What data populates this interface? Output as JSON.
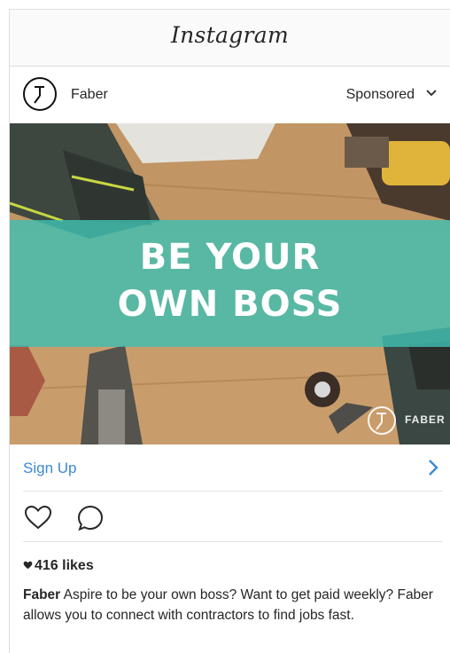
{
  "app": {
    "title": "Instagram"
  },
  "post": {
    "account_name": "Faber",
    "sponsored_label": "Sponsored",
    "headline_line1": "BE YOUR",
    "headline_line2": "OWN BOSS",
    "image_brand": "FABER",
    "cta_label": "Sign Up",
    "likes_count": "416 likes",
    "caption_author": "Faber",
    "caption_text": "Aspire to be your own boss? Want to get paid weekly? Faber allows you to connect with contractors to find jobs fast."
  },
  "icons": {
    "sponsored_menu": "chevron-down-icon",
    "cta": "chevron-right-icon",
    "like": "heart-icon",
    "comment": "comment-icon",
    "likes_heart": "heart-icon",
    "avatar": "faber-logo"
  },
  "colors": {
    "link_blue": "#3b89d4",
    "banner_teal": "#40beb0",
    "text": "#262626"
  }
}
